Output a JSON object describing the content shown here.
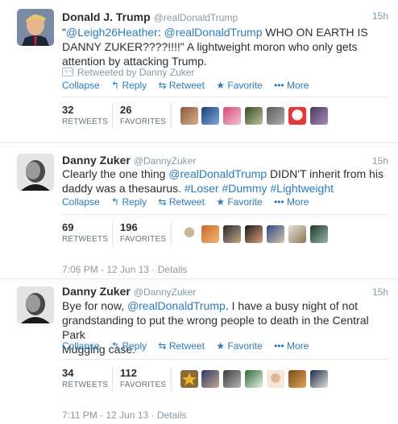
{
  "tweets": [
    {
      "name": "Donald J. Trump",
      "handle": "@realDonaldTrump",
      "time": "15h",
      "line1_a": "\"",
      "line1_link1": "@Leigh26Heather",
      "line1_b": ": ",
      "line1_link2": "@realDonaldTrump",
      "line1_c": " WHO ON EARTH IS",
      "line2": "DANNY ZUKER????!!!!\"  A lightweight moron who only gets",
      "line3": "attention by attacking Trump.",
      "retweeted_by": "Retweeted by Danny Zuker",
      "retweets": "32",
      "favorites": "26"
    },
    {
      "name": "Danny Zuker",
      "handle": "@DannyZuker",
      "time": "15h",
      "line1_a": "Clearly the one thing ",
      "line1_link1": "@realDonaldTrump",
      "line1_b": " DIDN'T inherit from his",
      "line2_a": "daddy was a thesaurus.  ",
      "line2_tag1": "#Loser",
      "line2_tag2": "#Dummy",
      "line2_tag3": "#Lightweight",
      "retweets": "69",
      "favorites": "196",
      "timestamp": "7:06 PM - 12 Jun 13",
      "details": "Details"
    },
    {
      "name": "Danny Zuker",
      "handle": "@DannyZuker",
      "time": "15h",
      "line1_a": "Bye for now, ",
      "line1_link1": "@realDonaldTrump",
      "line1_b": ". I have a busy night of not",
      "line2": "grandstanding to put the wrong people to death in the Central Park",
      "line3": "Mugging case.",
      "retweets": "34",
      "favorites": "112",
      "timestamp": "7:11 PM - 12 Jun 13",
      "details": "Details"
    }
  ],
  "labels": {
    "collapse": "Collapse",
    "reply": "Reply",
    "retweet": "Retweet",
    "favorite": "Favorite",
    "more": "More",
    "retweets_label": "RETWEETS",
    "favorites_label": "FAVORITES",
    "dot_sep": " · "
  },
  "colors": {
    "link": "#2b7bb9",
    "muted": "#8899a6",
    "text": "#292f33"
  }
}
